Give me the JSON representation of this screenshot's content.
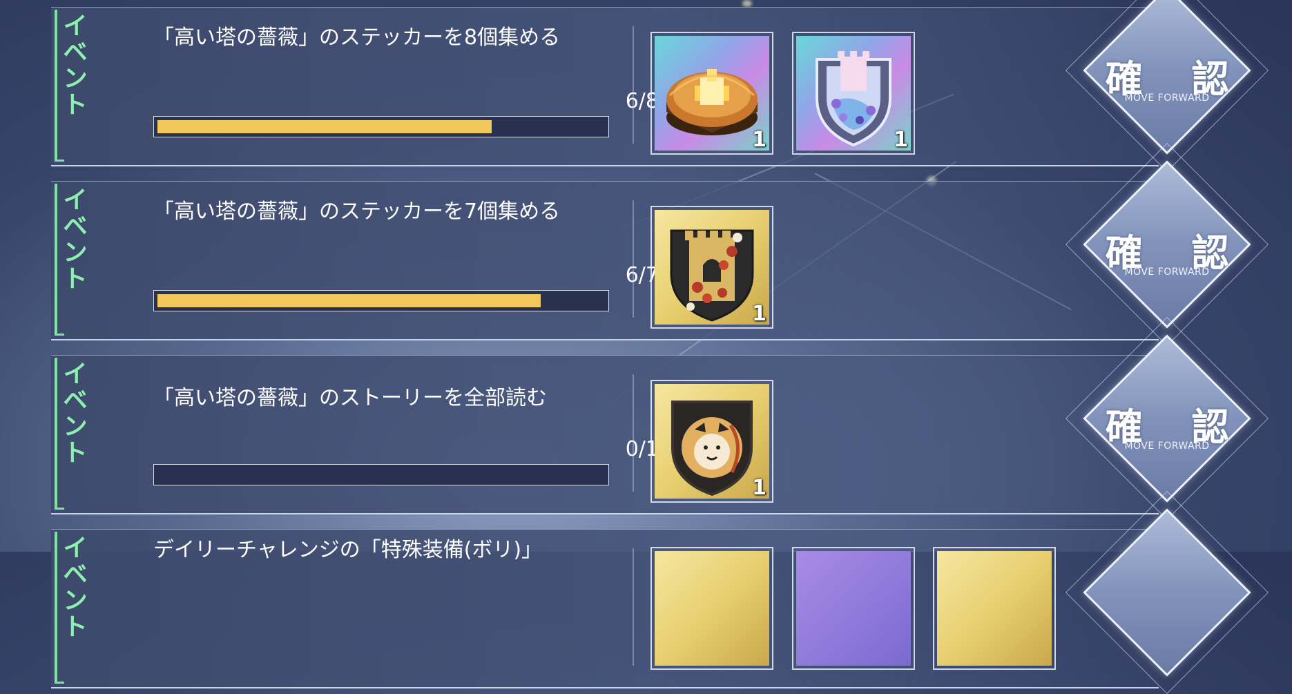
{
  "confirm_button": {
    "label": "確 認",
    "sub_label": "MOVE FORWARD"
  },
  "missions": [
    {
      "category": "イベント",
      "title": "「高い塔の薔薇」のステッカーを8個集める",
      "progress_text": "6/8",
      "progress": 0.75,
      "rewards": [
        {
          "icon": "rose-tower-diorama-icon",
          "quantity": "1"
        },
        {
          "icon": "rose-castle-shield-emblem-icon",
          "quantity": "1"
        }
      ]
    },
    {
      "category": "イベント",
      "title": "「高い塔の薔薇」のステッカーを7個集める",
      "progress_text": "6/7",
      "progress": 0.857,
      "rewards": [
        {
          "icon": "tower-roses-shield-sticker-icon",
          "quantity": "1"
        }
      ]
    },
    {
      "category": "イベント",
      "title": "「高い塔の薔薇」のストーリーを全部読む",
      "progress_text": "0/1",
      "progress": 0,
      "rewards": [
        {
          "icon": "lion-shield-sticker-icon",
          "quantity": "1"
        }
      ]
    },
    {
      "category": "イベント",
      "title": "デイリーチャレンジの「特殊装備(ボリ)」",
      "progress_text": "",
      "progress": 0,
      "rewards": []
    }
  ],
  "colors": {
    "accent_green": "#7ce6a0",
    "progress_fill": "#f2c85c",
    "panel": "#46547a"
  }
}
